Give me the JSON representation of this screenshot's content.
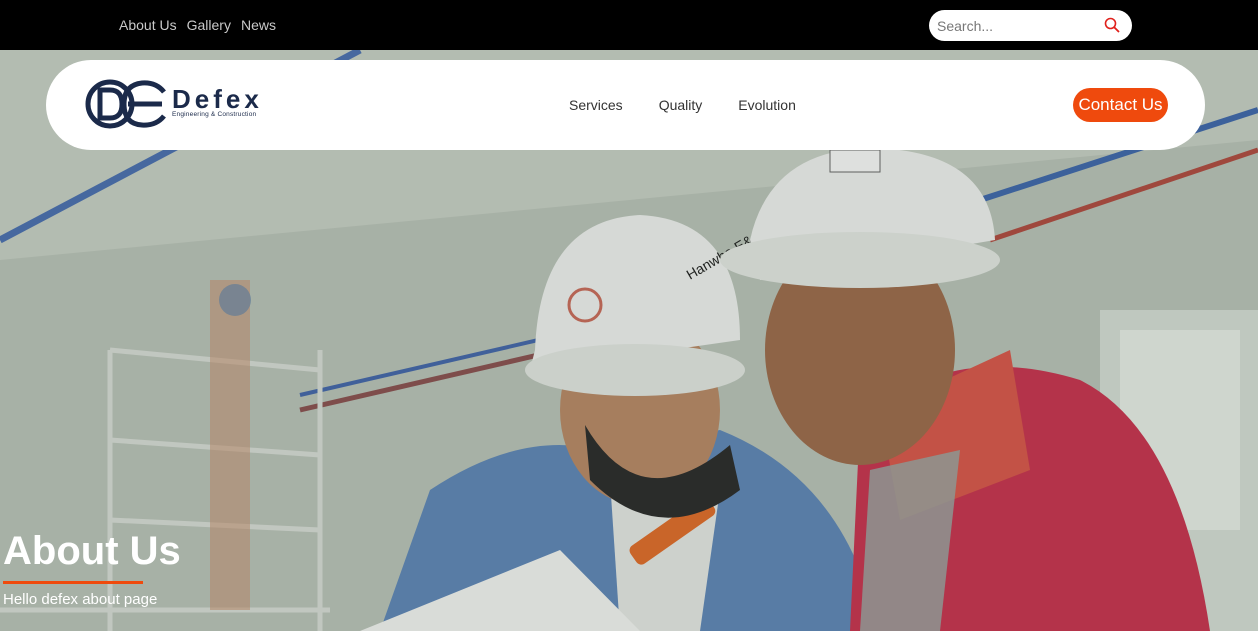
{
  "topbar": {
    "links": [
      "About Us",
      "Gallery",
      "News"
    ],
    "search_placeholder": "Search..."
  },
  "nav": {
    "brand": "Defex",
    "tagline": "Engineering & Construction",
    "items": [
      "Services",
      "Quality",
      "Evolution"
    ],
    "contact_label": "Contact Us"
  },
  "hero": {
    "title": "About Us",
    "subtitle": "Hello defex about page",
    "helmet_text": "Hanwha E&C"
  },
  "colors": {
    "accent": "#ef4a0d",
    "brand_navy": "#1b2a4a",
    "topbar_bg": "#000000"
  }
}
